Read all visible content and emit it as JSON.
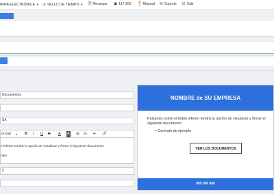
{
  "topbar": {
    "items": [
      {
        "label": "IRMA ELECTRÓNICA",
        "icon": "caret-down",
        "caret": "▼"
      },
      {
        "label": "SELLO DE TIEMPO",
        "icon": "clock-icon",
        "glyph": "◷",
        "caret": "▼"
      },
      {
        "label": "Recargar",
        "icon": "reload-icon",
        "glyph": "⎘"
      },
      {
        "label": "117,20€",
        "icon": "wallet-icon",
        "glyph": "▣"
      },
      {
        "label": "Manual",
        "icon": "help-icon",
        "glyph": "❓"
      },
      {
        "label": "Soporte",
        "icon": "mail-icon",
        "glyph": "✉"
      },
      {
        "label": "Salir",
        "icon": "logout-icon",
        "glyph": "⏻"
      }
    ]
  },
  "form": {
    "title_field": "Documentos",
    "field3": "SA",
    "field5": "5"
  },
  "toolbar": {
    "format": "ormal",
    "bold": "B",
    "italic": "I",
    "underline": "U",
    "strike": "S",
    "color": "A",
    "highlight": "A",
    "list_ol": "☰",
    "list_ul": "☷",
    "link": "🔗"
  },
  "editor": {
    "line1": "n inferior tendrá la opción de visualizar y firmar el siguiente documento:",
    "line2": "nplo"
  },
  "preview": {
    "company": "NOMBRE de SU EMPRESA",
    "text": "Pulsando sobre el botón inferior tendrá la opción de visualizar y firmar el siguiente documento:",
    "bullet": "Contrato de ejemplo",
    "button": "VER LOS DOCUMENTOS",
    "footer": "900 000 000"
  },
  "colors": {
    "accent": "#2d6fdc",
    "teal_line": "#7fa6a6"
  }
}
